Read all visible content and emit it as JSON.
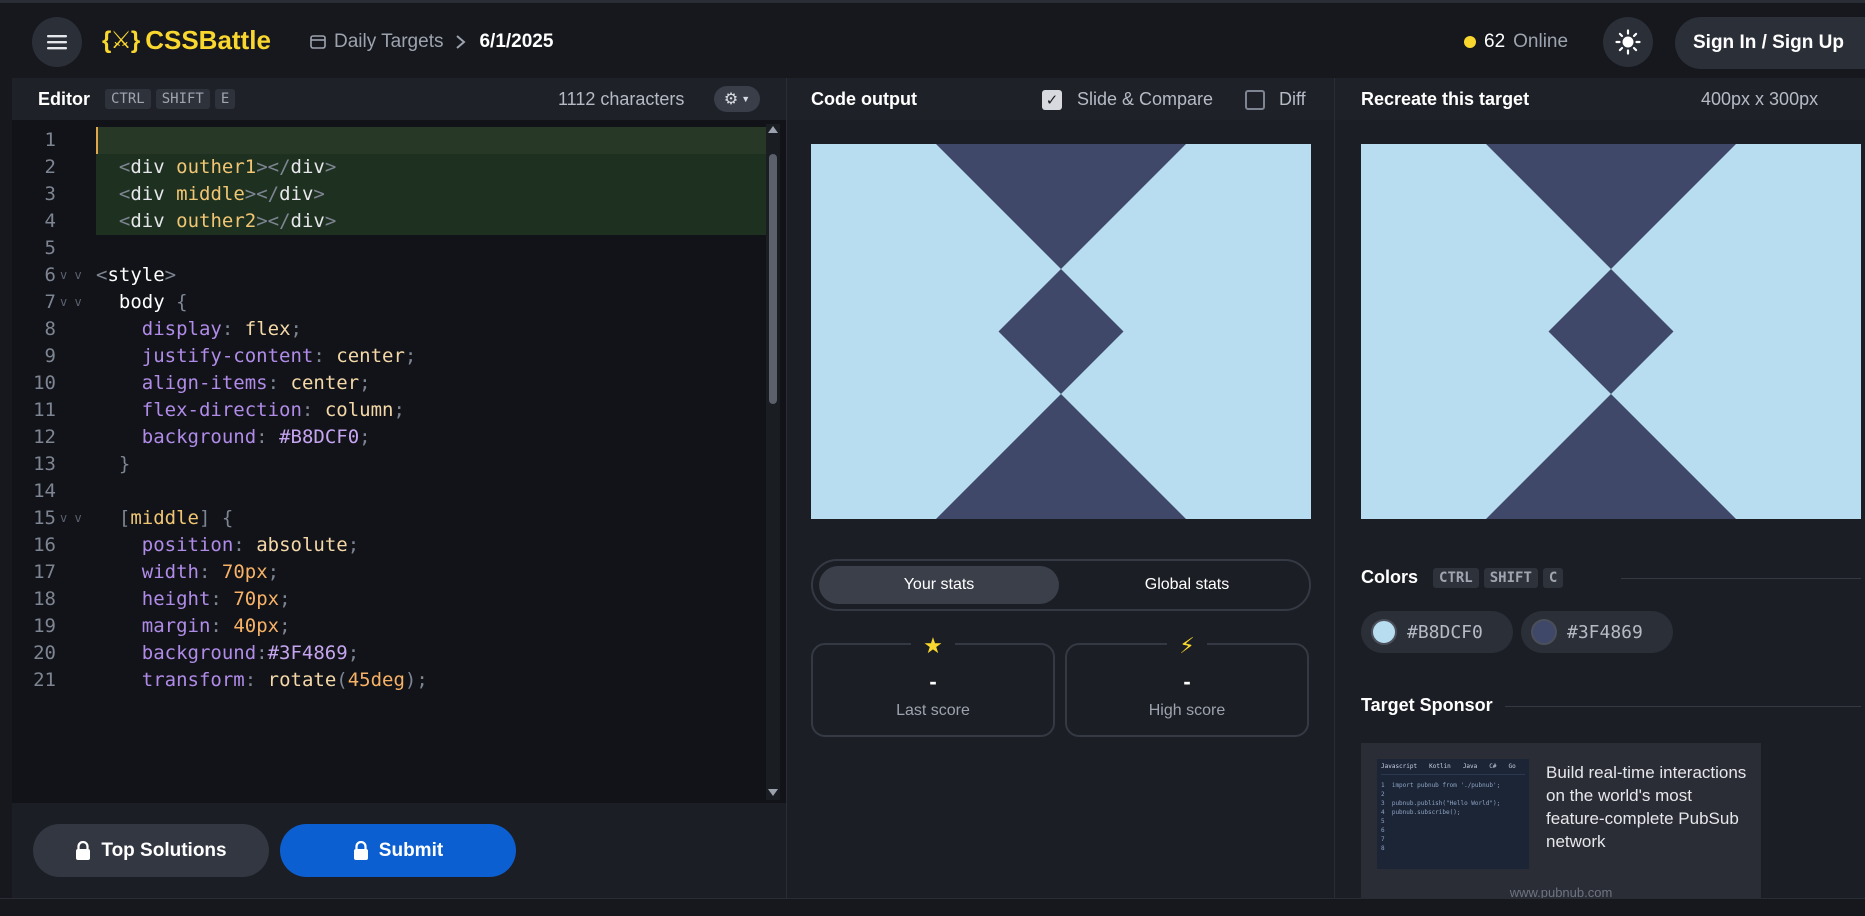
{
  "header": {
    "logo_text": "CSSBattle",
    "logo_mark": "{⚔}",
    "breadcrumb": {
      "section": "Daily Targets",
      "date": "6/1/2025"
    },
    "online": {
      "count": "62",
      "label": "Online"
    },
    "signin_label": "Sign In / Sign Up"
  },
  "editor": {
    "title": "Editor",
    "shortcut": [
      "CTRL",
      "SHIFT",
      "E"
    ],
    "characters": "1112 characters"
  },
  "code_lines": [
    "",
    "  <div outher1></div>",
    "  <div middle></div>",
    "  <div outher2></div>",
    "",
    "<style>",
    "  body {",
    "    display: flex;",
    "    justify-content: center;",
    "    align-items: center;",
    "    flex-direction: column;",
    "    background: #B8DCF0;",
    "  }",
    "",
    "  [middle] {",
    "    position: absolute;",
    "    width: 70px;",
    "    height: 70px;",
    "    margin: 40px;",
    "    background:#3F4869;",
    "    transform: rotate(45deg);"
  ],
  "editor_footer": {
    "top_solutions_label": "Top Solutions",
    "submit_label": "Submit"
  },
  "output": {
    "title": "Code output",
    "slide_compare_label": "Slide & Compare",
    "slide_compare_checked": true,
    "diff_label": "Diff",
    "diff_checked": false,
    "stats_tabs": [
      "Your stats",
      "Global stats"
    ],
    "last_score": {
      "value": "-",
      "label": "Last score"
    },
    "high_score": {
      "value": "-",
      "label": "High score"
    }
  },
  "target": {
    "title": "Recreate this target",
    "size": "400px x 300px",
    "colors_title": "Colors",
    "colors_shortcut": [
      "CTRL",
      "SHIFT",
      "C"
    ],
    "colors": [
      {
        "hex": "#B8DCF0",
        "label": "#B8DCF0"
      },
      {
        "hex": "#3F4869",
        "label": "#3F4869"
      }
    ],
    "sponsor_title": "Target Sponsor",
    "sponsor_text": "Build real-time interactions on the world's most feature-complete PubSub network",
    "sponsor_url": "www.pubnub.com",
    "sponsor_tabs": [
      "Javascript",
      "Kotlin",
      "Java",
      "C#",
      "Go"
    ],
    "sponsor_code": [
      "1  import pubnub from './pubnub';",
      "2",
      "3  pubnub.publish(\"Hello World\");",
      "4  pubnub.subscribe();",
      "5",
      "6",
      "7",
      "8"
    ]
  },
  "colors": {
    "accent": "#F9D72F",
    "submit": "#0C5FD1",
    "light": "#B8DCF0",
    "dark": "#3F4869"
  }
}
